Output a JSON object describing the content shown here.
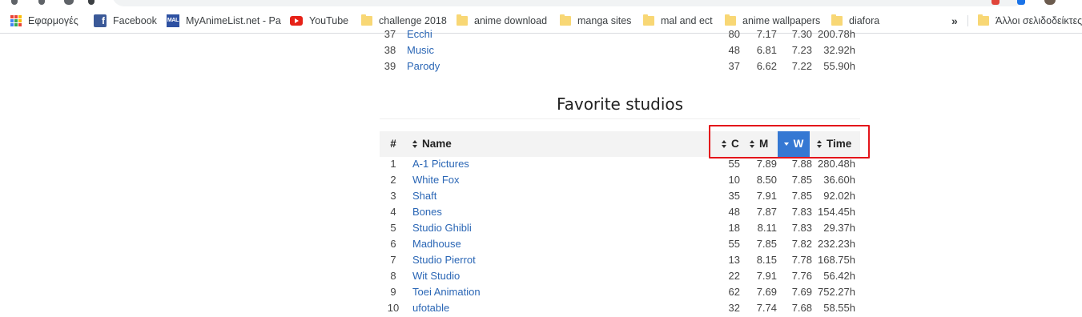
{
  "browser": {
    "bookmarks": [
      {
        "label": "Εφαρμογές",
        "icon": "apps-grid-icon"
      },
      {
        "label": "Facebook",
        "icon": "facebook-icon"
      },
      {
        "label": "MyAnimeList.net - Pa",
        "icon": "myanimelist-icon"
      },
      {
        "label": "YouTube",
        "icon": "youtube-icon"
      },
      {
        "label": "challenge 2018",
        "icon": "folder-icon"
      },
      {
        "label": "anime download",
        "icon": "folder-icon"
      },
      {
        "label": "manga sites",
        "icon": "folder-icon"
      },
      {
        "label": "mal and ect",
        "icon": "folder-icon"
      },
      {
        "label": "anime wallpapers",
        "icon": "folder-icon"
      },
      {
        "label": "diafora",
        "icon": "folder-icon"
      }
    ],
    "overflow_label": "»",
    "other_bookmarks_label": "Άλλοι σελιδοδείκτες"
  },
  "genres_tail": [
    {
      "num": "37",
      "name": "Ecchi",
      "c": "80",
      "m": "7.17",
      "w": "7.30",
      "t": "200.78h"
    },
    {
      "num": "38",
      "name": "Music",
      "c": "48",
      "m": "6.81",
      "w": "7.23",
      "t": "32.92h"
    },
    {
      "num": "39",
      "name": "Parody",
      "c": "37",
      "m": "6.62",
      "w": "7.22",
      "t": "55.90h"
    }
  ],
  "studios": {
    "title": "Favorite studios",
    "headers": {
      "num": "#",
      "name": "Name",
      "c": "C",
      "m": "M",
      "w": "W",
      "time": "Time"
    },
    "sorted_column": "W",
    "rows": [
      {
        "num": "1",
        "name": "A-1 Pictures",
        "c": "55",
        "m": "7.89",
        "w": "7.88",
        "t": "280.48h"
      },
      {
        "num": "2",
        "name": "White Fox",
        "c": "10",
        "m": "8.50",
        "w": "7.85",
        "t": "36.60h"
      },
      {
        "num": "3",
        "name": "Shaft",
        "c": "35",
        "m": "7.91",
        "w": "7.85",
        "t": "92.02h"
      },
      {
        "num": "4",
        "name": "Bones",
        "c": "48",
        "m": "7.87",
        "w": "7.83",
        "t": "154.45h"
      },
      {
        "num": "5",
        "name": "Studio Ghibli",
        "c": "18",
        "m": "8.11",
        "w": "7.83",
        "t": "29.37h"
      },
      {
        "num": "6",
        "name": "Madhouse",
        "c": "55",
        "m": "7.85",
        "w": "7.82",
        "t": "232.23h"
      },
      {
        "num": "7",
        "name": "Studio Pierrot",
        "c": "13",
        "m": "8.15",
        "w": "7.78",
        "t": "168.75h"
      },
      {
        "num": "8",
        "name": "Wit Studio",
        "c": "22",
        "m": "7.91",
        "w": "7.76",
        "t": "56.42h"
      },
      {
        "num": "9",
        "name": "Toei Animation",
        "c": "62",
        "m": "7.69",
        "w": "7.69",
        "t": "752.27h"
      },
      {
        "num": "10",
        "name": "ufotable",
        "c": "32",
        "m": "7.74",
        "w": "7.68",
        "t": "58.55h"
      }
    ]
  },
  "colors": {
    "link": "#2a66b5",
    "sorted_header": "#3578d3",
    "highlight_box": "#e4151b"
  }
}
